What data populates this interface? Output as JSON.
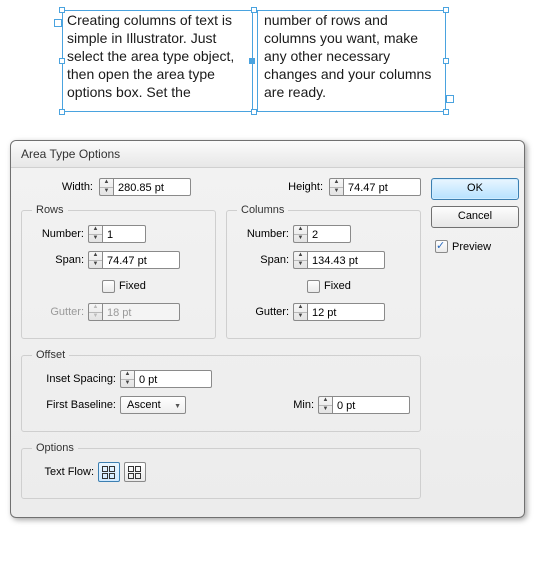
{
  "textframe": {
    "col1": "Creating columns of text is simple in Illustrator. Just select the area type object, then open the area type options box. Set the",
    "col2": "number of rows and columns you want, make any other necessary changes and your columns are ready."
  },
  "dialog": {
    "title": "Area Type Options",
    "width_label": "Width:",
    "width_value": "280.85 pt",
    "height_label": "Height:",
    "height_value": "74.47 pt",
    "rows": {
      "legend": "Rows",
      "number_label": "Number:",
      "number_value": "1",
      "span_label": "Span:",
      "span_value": "74.47 pt",
      "fixed_label": "Fixed",
      "gutter_label": "Gutter:",
      "gutter_value": "18 pt"
    },
    "cols": {
      "legend": "Columns",
      "number_label": "Number:",
      "number_value": "2",
      "span_label": "Span:",
      "span_value": "134.43 pt",
      "fixed_label": "Fixed",
      "gutter_label": "Gutter:",
      "gutter_value": "12 pt"
    },
    "offset": {
      "legend": "Offset",
      "inset_label": "Inset Spacing:",
      "inset_value": "0 pt",
      "baseline_label": "First Baseline:",
      "baseline_value": "Ascent",
      "min_label": "Min:",
      "min_value": "0 pt"
    },
    "options": {
      "legend": "Options",
      "flow_label": "Text Flow:"
    },
    "buttons": {
      "ok": "OK",
      "cancel": "Cancel",
      "preview": "Preview"
    }
  }
}
